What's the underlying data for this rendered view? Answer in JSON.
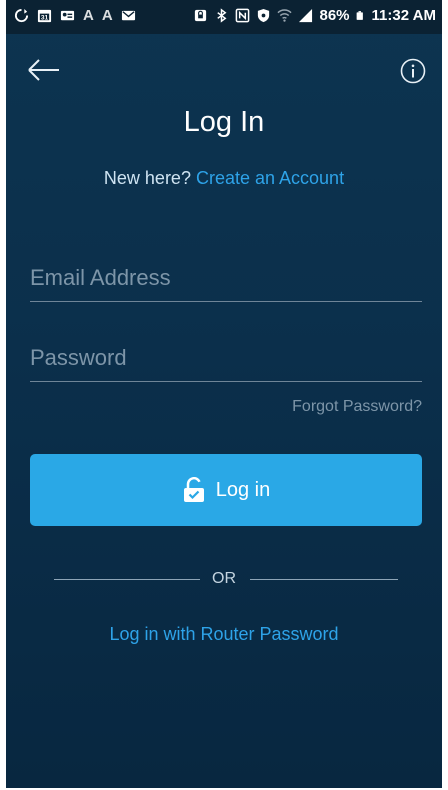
{
  "status_bar": {
    "left_icons": [
      "sync-icon",
      "calendar-icon",
      "contact-card-icon"
    ],
    "left_letters": [
      "A",
      "A"
    ],
    "mail_icon": "mail-icon",
    "right_icons": [
      "lock-icon",
      "bluetooth-icon",
      "nfc-icon",
      "shield-icon",
      "wifi-icon",
      "signal-icon"
    ],
    "battery_percent": "86%",
    "battery_icon": "battery-icon",
    "time": "11:32 AM"
  },
  "header": {
    "back_icon": "arrow-left-icon",
    "info_icon": "info-icon",
    "title": "Log In"
  },
  "signup": {
    "prompt": "New here?",
    "link": "Create an Account"
  },
  "form": {
    "email_placeholder": "Email Address",
    "email_value": "",
    "password_placeholder": "Password",
    "password_value": "",
    "forgot_label": "Forgot Password?"
  },
  "login_button": {
    "icon": "unlock-icon",
    "label": "Log in"
  },
  "divider": {
    "label": "OR"
  },
  "router_login": {
    "label": "Log in with Router Password"
  },
  "colors": {
    "background": "#0b2f4b",
    "accent": "#2aa8e6",
    "link": "#2ea3e8"
  }
}
